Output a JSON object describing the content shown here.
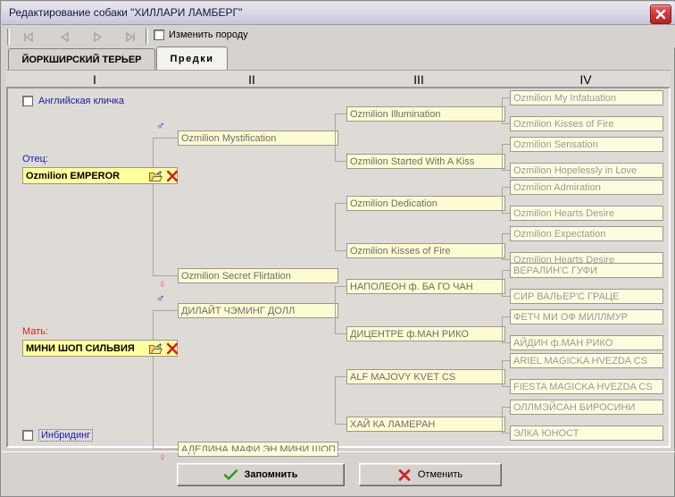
{
  "window": {
    "title": "Редактирование собаки \"ХИЛЛАРИ ЛАМБЕРГ\"",
    "close_icon": "close-icon"
  },
  "toolbar": {
    "nav": [
      {
        "name": "first-record-button",
        "glyph": "first-record-icon"
      },
      {
        "name": "prev-record-button",
        "glyph": "prev-record-icon"
      },
      {
        "name": "next-record-button",
        "glyph": "next-record-icon"
      },
      {
        "name": "last-record-button",
        "glyph": "last-record-icon"
      }
    ],
    "change_breed_label": "Изменить породу",
    "change_breed_checked": false
  },
  "tabs": [
    {
      "label": "ЙОРКШИРСКИЙ ТЕРЬЕР",
      "active": false,
      "name": "tab-breed"
    },
    {
      "label": "Предки",
      "active": true,
      "name": "tab-ancestors"
    }
  ],
  "columns": [
    "I",
    "II",
    "III",
    "IV"
  ],
  "options": {
    "english_name_label": "Английская кличка",
    "english_name_checked": false,
    "inbreeding_label": "Инбридинг",
    "inbreeding_checked": false
  },
  "pedigree": {
    "father": {
      "label": "Отец:",
      "value": "Ozmilion EMPEROR",
      "open_icon": "open-folder-icon",
      "delete_icon": "delete-red-x-icon",
      "sire_symbol": "male-symbol-icon",
      "dam_symbol": "female-symbol-icon",
      "gen2": [
        "Ozmilion Mystification",
        "Ozmilion Secret Flirtation"
      ],
      "gen3": [
        "Ozmilion Illumination",
        "Ozmilion Started With A Kiss",
        "Ozmilion Dedication",
        "Ozmilion Kisses of Fire"
      ],
      "gen4": [
        "Ozmilion My Infatuation",
        "Ozmilion Kisses of Fire",
        "Ozmilion Sensation",
        "Ozmilion Hopelessly in Love",
        "Ozmilion Admiration",
        "Ozmilion Hearts Desire",
        "Ozmilion Expectation",
        "Ozmilion Hearts Desire"
      ]
    },
    "mother": {
      "label": "Мать:",
      "value": "МИНИ ШОП СИЛЬВИЯ",
      "open_icon": "open-folder-icon",
      "delete_icon": "delete-red-x-icon",
      "sire_symbol": "male-symbol-icon",
      "dam_symbol": "female-symbol-icon",
      "gen2": [
        "ДИЛАЙТ ЧЭМИНГ ДОЛЛ",
        "АДЕЛИНА МАФИ ЭН МИНИ ШОП"
      ],
      "gen3": [
        "НАПОЛЕОН ф. БА ГО ЧАН",
        "ДИЦЕНТРЕ ф.МАН РИКО",
        "ALF MAJOVY KVET CS",
        "ХАЙ КА ЛАМЕРАН"
      ],
      "gen4": [
        "ВЕРАЛИН'С ГУФИ",
        "СИР ВАЛЬЕР'С ГРАЦЕ",
        "ФЕТЧ МИ ОФ МИЛЛМУР",
        "АЙДИН ф.МАН РИКО",
        "ARIEL MAGICKA HVEZDA CS",
        "FIESTA MAGICKA HVEZDA CS",
        "ОЛЛМЭЙСАН БИРОСИНИ",
        "ЭЛКА ЮНОСТ"
      ]
    }
  },
  "buttons": {
    "save_label": "Запомнить",
    "save_icon": "green-check-icon",
    "cancel_label": "Отменить",
    "cancel_icon": "red-x-icon"
  },
  "colors": {
    "window_bg": "#d6d3ce",
    "gen1_field": "#ffff9e",
    "gen23_field": "#fdfbd2",
    "gen4_field": "#fdfcdf",
    "father_label": "#1a1aa8",
    "mother_label": "#d02020",
    "male_symbol": "#1a1acc",
    "female_symbol": "#e05a7a"
  }
}
